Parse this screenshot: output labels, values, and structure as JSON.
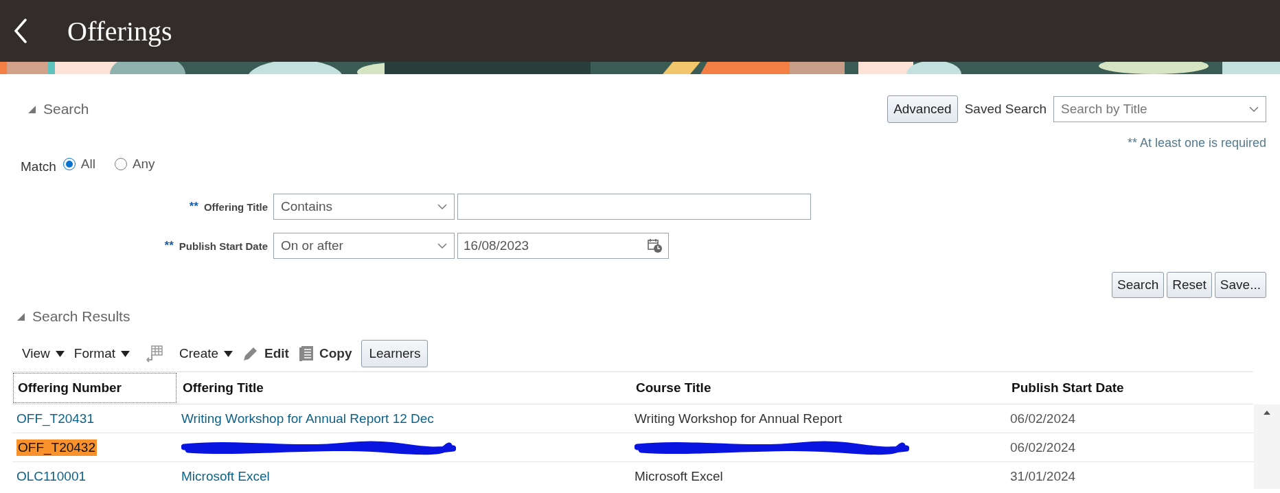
{
  "header": {
    "title": "Offerings",
    "kind": "picture"
  },
  "search": {
    "heading": "Search",
    "expanded": true,
    "advanced_button": "Advanced",
    "saved_search_label": "Saved Search",
    "saved_search": {
      "placeholder": "Search by Title"
    },
    "required_note": "** At least one is required",
    "match": {
      "label": "Match",
      "options": [
        {
          "label": "All",
          "selected": true
        },
        {
          "label": "Any",
          "selected": false
        }
      ]
    },
    "criteria": [
      {
        "marker": "**",
        "label": "Offering Title",
        "operator": "Contains",
        "kind": "text"
      },
      {
        "marker": "**",
        "label": "Publish Start Date",
        "operator": "On or after",
        "value": "16/08/2023",
        "kind": "date"
      }
    ],
    "buttons": [
      "Search",
      "Reset",
      "Save..."
    ]
  },
  "results": {
    "heading": "Search Results",
    "expanded": true,
    "toolbar": [
      {
        "kind": "menu",
        "label": "View"
      },
      {
        "kind": "menu",
        "label": "Format"
      },
      {
        "kind": "freeze"
      },
      {
        "kind": "menu",
        "label": "Create"
      },
      {
        "kind": "edit",
        "label": "Edit"
      },
      {
        "kind": "copy",
        "label": "Copy"
      },
      {
        "kind": "button",
        "label": "Learners"
      }
    ],
    "columns": [
      "Offering Number",
      "Offering Title",
      "Course Title",
      "Publish Start Date"
    ],
    "rows": [
      {
        "highlighted": false,
        "cells": [
          {
            "kind": "link",
            "text": "OFF_T20431"
          },
          {
            "kind": "link",
            "text": "Writing Workshop for Annual Report 12 Dec"
          },
          {
            "kind": "text",
            "text": "Writing Workshop for Annual Report"
          },
          {
            "kind": "date",
            "text": "06/02/2024"
          }
        ]
      },
      {
        "highlighted": true,
        "cells": [
          {
            "kind": "link",
            "text": "OFF_T20432"
          },
          {
            "kind": "redacted"
          },
          {
            "kind": "redacted"
          },
          {
            "kind": "date",
            "text": "06/02/2024"
          }
        ]
      },
      {
        "highlighted": false,
        "cells": [
          {
            "kind": "link",
            "text": "OLC110001"
          },
          {
            "kind": "link",
            "text": "Microsoft Excel"
          },
          {
            "kind": "text",
            "text": "Microsoft Excel"
          },
          {
            "kind": "date",
            "text": "31/01/2024"
          }
        ]
      }
    ]
  }
}
